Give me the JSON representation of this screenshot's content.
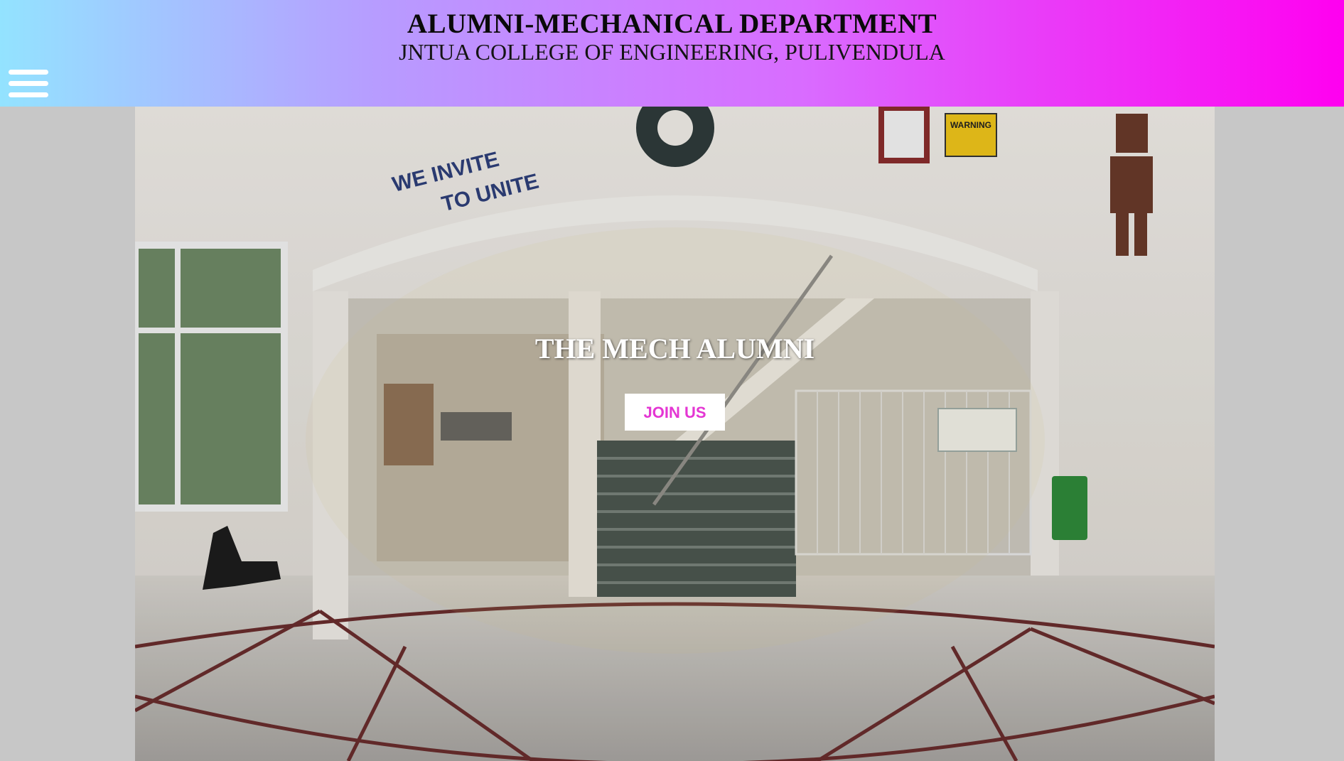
{
  "header": {
    "title": "ALUMNI-MECHANICAL DEPARTMENT",
    "subtitle": "JNTUA COLLEGE OF ENGINEERING, PULIVENDULA"
  },
  "menu": {
    "icon": "hamburger-menu-icon"
  },
  "hero": {
    "wall_text_1": "WE INVITE",
    "wall_text_2": "TO UNITE",
    "warning_sign": "WARNING",
    "title": "THE MECH ALUMNI",
    "join_label": "JOIN US"
  },
  "colors": {
    "header_gradient_start": "#93e3ff",
    "header_gradient_end": "#ff00f0",
    "join_text": "#e436d3",
    "page_background": "#c7c7c7"
  }
}
